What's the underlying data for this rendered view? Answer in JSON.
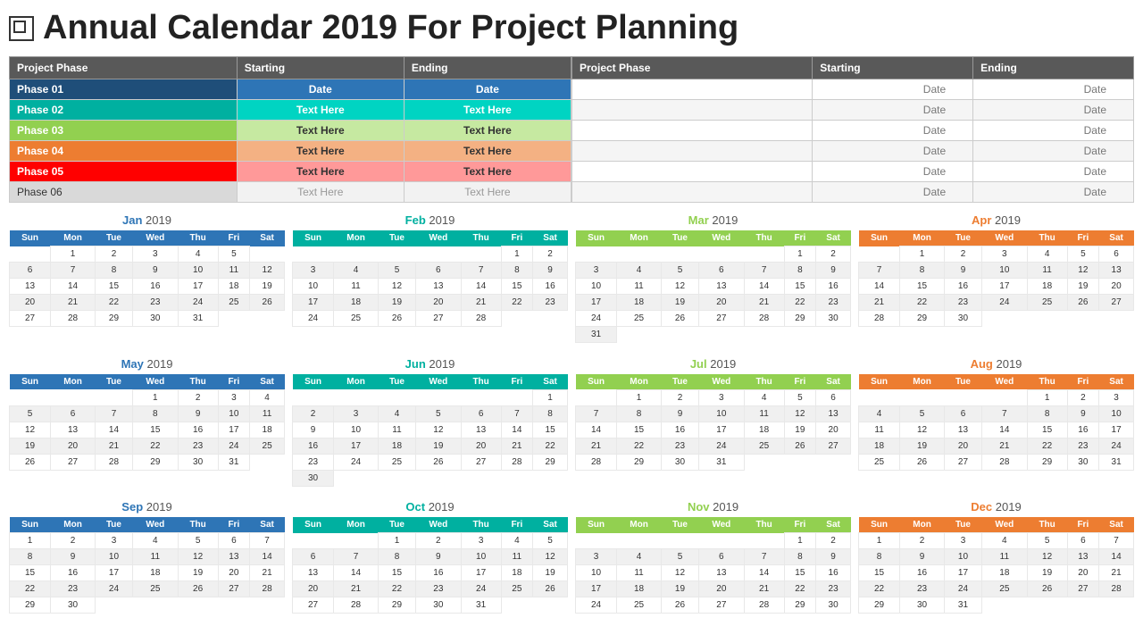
{
  "title": "Annual Calendar 2019 For Project Planning",
  "phases_left": {
    "headers": [
      "Project Phase",
      "Starting",
      "Ending"
    ],
    "rows": [
      {
        "id": "01",
        "label": "Phase 01",
        "start": "Date",
        "end": "Date",
        "color": "phase-01"
      },
      {
        "id": "02",
        "label": "Phase 02",
        "start": "Text Here",
        "end": "Text Here",
        "color": "phase-02"
      },
      {
        "id": "03",
        "label": "Phase 03",
        "start": "Text Here",
        "end": "Text Here",
        "color": "phase-03"
      },
      {
        "id": "04",
        "label": "Phase 04",
        "start": "Text Here",
        "end": "Text Here",
        "color": "phase-04"
      },
      {
        "id": "05",
        "label": "Phase 05",
        "start": "Text Here",
        "end": "Text Here",
        "color": "phase-05"
      },
      {
        "id": "06",
        "label": "Phase 06",
        "start": "Text Here",
        "end": "Text Here",
        "color": "phase-06"
      }
    ]
  },
  "phases_right": {
    "headers": [
      "Project Phase",
      "Starting",
      "Ending"
    ],
    "rows": [
      {
        "start": "Date",
        "end": "Date"
      },
      {
        "start": "Date",
        "end": "Date"
      },
      {
        "start": "Date",
        "end": "Date"
      },
      {
        "start": "Date",
        "end": "Date"
      },
      {
        "start": "Date",
        "end": "Date"
      },
      {
        "start": "Date",
        "end": "Date"
      }
    ]
  },
  "months": [
    {
      "name": "Jan",
      "year": "2019",
      "color": "blue",
      "days": [
        [
          0,
          1,
          2,
          3,
          4,
          5
        ],
        [
          6,
          7,
          8,
          9,
          10,
          11,
          12
        ],
        [
          13,
          14,
          15,
          16,
          17,
          18,
          19
        ],
        [
          20,
          21,
          22,
          23,
          24,
          25,
          26
        ],
        [
          27,
          28,
          29,
          30,
          31,
          0,
          0
        ]
      ]
    },
    {
      "name": "Feb",
      "year": "2019",
      "color": "teal",
      "days": [
        [
          0,
          0,
          0,
          0,
          0,
          1,
          2
        ],
        [
          3,
          4,
          5,
          6,
          7,
          8,
          9
        ],
        [
          10,
          11,
          12,
          13,
          14,
          15,
          16
        ],
        [
          17,
          18,
          19,
          20,
          21,
          22,
          23
        ],
        [
          24,
          25,
          26,
          27,
          28,
          0,
          0
        ]
      ]
    },
    {
      "name": "Mar",
      "year": "2019",
      "color": "green",
      "days": [
        [
          0,
          0,
          0,
          0,
          0,
          1,
          2
        ],
        [
          3,
          4,
          5,
          6,
          7,
          8,
          9
        ],
        [
          10,
          11,
          12,
          13,
          14,
          15,
          16
        ],
        [
          17,
          18,
          19,
          20,
          21,
          22,
          23
        ],
        [
          24,
          25,
          26,
          27,
          28,
          29,
          30
        ],
        [
          31,
          0,
          0,
          0,
          0,
          0,
          0
        ]
      ]
    },
    {
      "name": "Apr",
      "year": "2019",
      "color": "orange",
      "days": [
        [
          0,
          1,
          2,
          3,
          4,
          5,
          6
        ],
        [
          7,
          8,
          9,
          10,
          11,
          12,
          13
        ],
        [
          14,
          15,
          16,
          17,
          18,
          19,
          20
        ],
        [
          21,
          22,
          23,
          24,
          25,
          26,
          27
        ],
        [
          28,
          29,
          30,
          0,
          0,
          0,
          0
        ]
      ]
    },
    {
      "name": "May",
      "year": "2019",
      "color": "blue",
      "days": [
        [
          0,
          0,
          0,
          1,
          2,
          3,
          4
        ],
        [
          5,
          6,
          7,
          8,
          9,
          10,
          11
        ],
        [
          12,
          13,
          14,
          15,
          16,
          17,
          18
        ],
        [
          19,
          20,
          21,
          22,
          23,
          24,
          25
        ],
        [
          26,
          27,
          28,
          29,
          30,
          31,
          0
        ]
      ]
    },
    {
      "name": "Jun",
      "year": "2019",
      "color": "teal",
      "days": [
        [
          0,
          0,
          0,
          0,
          0,
          0,
          1
        ],
        [
          2,
          3,
          4,
          5,
          6,
          7,
          8
        ],
        [
          9,
          10,
          11,
          12,
          13,
          14,
          15
        ],
        [
          16,
          17,
          18,
          19,
          20,
          21,
          22
        ],
        [
          23,
          24,
          25,
          26,
          27,
          28,
          29
        ],
        [
          30,
          0,
          0,
          0,
          0,
          0,
          0
        ]
      ]
    },
    {
      "name": "Jul",
      "year": "2019",
      "color": "green",
      "days": [
        [
          0,
          1,
          2,
          3,
          4,
          5,
          6
        ],
        [
          7,
          8,
          9,
          10,
          11,
          12,
          13
        ],
        [
          14,
          15,
          16,
          17,
          18,
          19,
          20
        ],
        [
          21,
          22,
          23,
          24,
          25,
          26,
          27
        ],
        [
          28,
          29,
          30,
          31,
          0,
          0,
          0
        ]
      ]
    },
    {
      "name": "Aug",
      "year": "2019",
      "color": "orange",
      "days": [
        [
          0,
          0,
          0,
          0,
          1,
          2,
          3
        ],
        [
          4,
          5,
          6,
          7,
          8,
          9,
          10
        ],
        [
          11,
          12,
          13,
          14,
          15,
          16,
          17
        ],
        [
          18,
          19,
          20,
          21,
          22,
          23,
          24
        ],
        [
          25,
          26,
          27,
          28,
          29,
          30,
          31
        ]
      ]
    },
    {
      "name": "Sep",
      "year": "2019",
      "color": "blue",
      "days": [
        [
          1,
          2,
          3,
          4,
          5,
          6,
          7
        ],
        [
          8,
          9,
          10,
          11,
          12,
          13,
          14
        ],
        [
          15,
          16,
          17,
          18,
          19,
          20,
          21
        ],
        [
          22,
          23,
          24,
          25,
          26,
          27,
          28
        ],
        [
          29,
          30,
          0,
          0,
          0,
          0,
          0
        ]
      ]
    },
    {
      "name": "Oct",
      "year": "2019",
      "color": "teal",
      "days": [
        [
          0,
          0,
          1,
          2,
          3,
          4,
          5
        ],
        [
          6,
          7,
          8,
          9,
          10,
          11,
          12
        ],
        [
          13,
          14,
          15,
          16,
          17,
          18,
          19
        ],
        [
          20,
          21,
          22,
          23,
          24,
          25,
          26
        ],
        [
          27,
          28,
          29,
          30,
          31,
          0,
          0
        ]
      ]
    },
    {
      "name": "Nov",
      "year": "2019",
      "color": "green",
      "days": [
        [
          0,
          0,
          0,
          0,
          0,
          1,
          2
        ],
        [
          3,
          4,
          5,
          6,
          7,
          8,
          9
        ],
        [
          10,
          11,
          12,
          13,
          14,
          15,
          16
        ],
        [
          17,
          18,
          19,
          20,
          21,
          22,
          23
        ],
        [
          24,
          25,
          26,
          27,
          28,
          29,
          30
        ]
      ]
    },
    {
      "name": "Dec",
      "year": "2019",
      "color": "orange",
      "days": [
        [
          1,
          2,
          3,
          4,
          5,
          6,
          7
        ],
        [
          8,
          9,
          10,
          11,
          12,
          13,
          14
        ],
        [
          15,
          16,
          17,
          18,
          19,
          20,
          21
        ],
        [
          22,
          23,
          24,
          25,
          26,
          27,
          28
        ],
        [
          29,
          30,
          31,
          0,
          0,
          0,
          0
        ]
      ]
    }
  ],
  "weekdays": [
    "Sun",
    "Mon",
    "Tue",
    "Wed",
    "Thu",
    "Fri",
    "Sat"
  ]
}
